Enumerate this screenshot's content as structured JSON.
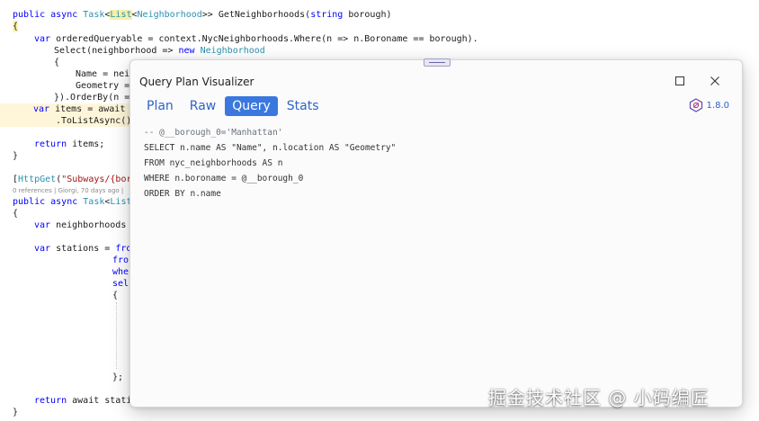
{
  "editor": {
    "lines": {
      "l1_pub": "public async ",
      "l1_task": "Task",
      "l1_lt": "<",
      "l1_list": "List",
      "l1_lt2": "<",
      "l1_nb": "Neighborhood",
      "l1_rest": ">> GetNeighborhoods(",
      "l1_string": "string",
      "l1_end": " borough)",
      "l2": "{",
      "l3_var": "var",
      "l3_rest": " orderedQueryable = context.NycNeighborhoods.Where(n => n.Boroname == borough).",
      "l4_a": "Select(neighborhood => ",
      "l4_new": "new",
      "l4_nb": " Neighborhood",
      "l5": "{",
      "l6": "Name = nei",
      "l7": "Geometry =",
      "l8": "}).OrderBy(n =",
      "l9_var": "var",
      "l9_rest": " items = await",
      "l10": ".ToListAsync()",
      "l11_return": "return",
      "l11_rest": " items;",
      "l12": "}",
      "l13_a": "[",
      "l13_http": "HttpGet",
      "l13_b": "(",
      "l13_str": "\"Subways/{bor",
      "l14_meta": "0 references | Giorgi, 70 days ago |",
      "l15_pub": "public async ",
      "l15_task": "Task",
      "l15_lt": "<",
      "l15_list": "List",
      "l16": "{",
      "l17_var": "var",
      "l17_rest": " neighborhoods =",
      "l18_var": "var",
      "l18_rest": " stations = ",
      "l18_from": "fro",
      "l19": "fro",
      "l20": "whe",
      "l21": "sel",
      "l22": "{",
      "l23": "};",
      "l24_return": "return",
      "l24_rest": " await stati",
      "l25": "}"
    }
  },
  "dialog": {
    "title": "Query Plan Visualizer",
    "tabs": [
      "Plan",
      "Raw",
      "Query",
      "Stats"
    ],
    "active_tab": "Query",
    "version": "1.8.0",
    "icons": {
      "maximize": "maximize-icon",
      "close": "close-icon",
      "logo": "postgis-logo-icon"
    },
    "sql_lines": [
      "-- @__borough_0='Manhattan'",
      "SELECT n.name AS \"Name\", n.location AS \"Geometry\"",
      "FROM nyc_neighborhoods AS n",
      "WHERE n.boroname = @__borough_0",
      "ORDER BY n.name"
    ]
  },
  "colors": {
    "accent": "#3a78e0",
    "keyword": "#0000ff",
    "type": "#2b91af",
    "string": "#a31515",
    "line_highlight": "#fff6d9"
  },
  "watermark": "掘金技术社区 @ 小码编匠"
}
